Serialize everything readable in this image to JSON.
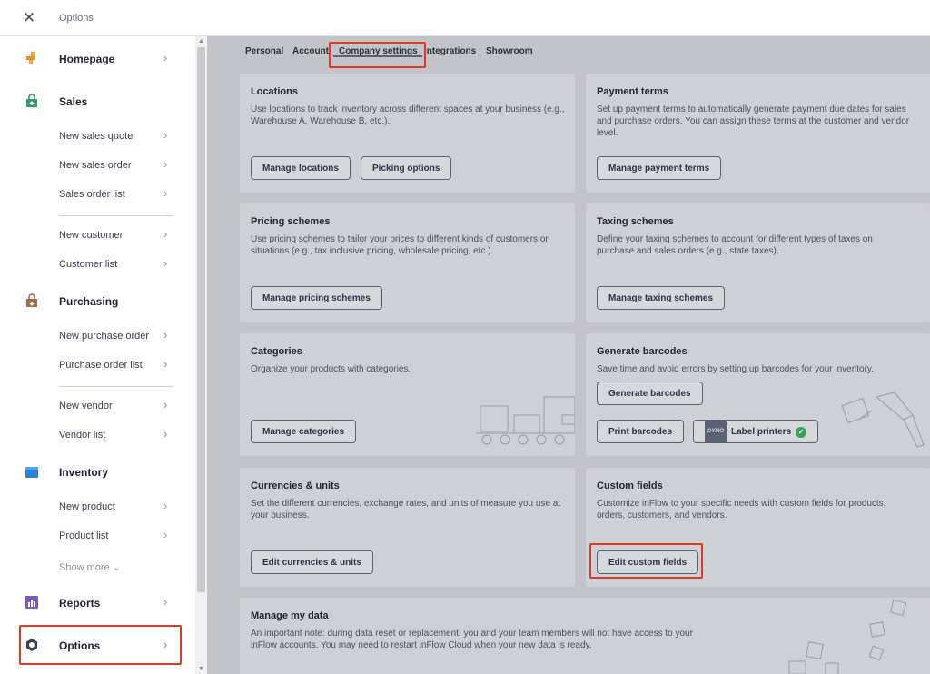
{
  "topbar": {
    "close_symbol": "✕",
    "title": "Options"
  },
  "sidebar": {
    "sections": {
      "homepage": "Homepage",
      "sales": "Sales",
      "purchasing": "Purchasing",
      "inventory": "Inventory",
      "reports": "Reports",
      "options": "Options"
    },
    "items": {
      "new_sales_quote": "New sales quote",
      "new_sales_order": "New sales order",
      "sales_order_list": "Sales order list",
      "new_customer": "New customer",
      "customer_list": "Customer list",
      "new_purchase_order": "New purchase order",
      "purchase_order_list": "Purchase order list",
      "new_vendor": "New vendor",
      "vendor_list": "Vendor list",
      "new_product": "New product",
      "product_list": "Product list",
      "show_more": "Show more ⌄"
    },
    "chevron": "›",
    "icon_names": [
      "homepage-icon",
      "sales-bag-icon",
      "purchasing-bag-icon",
      "inventory-box-icon",
      "reports-chart-icon",
      "options-gear-icon"
    ]
  },
  "tabs": {
    "personal": "Personal",
    "account": "Account",
    "company_settings": "Company settings",
    "integrations": "Integrations",
    "showroom": "Showroom"
  },
  "cards": {
    "locations": {
      "title": "Locations",
      "desc": "Use locations to track inventory across different spaces at your business (e.g., Warehouse A, Warehouse B, etc.).",
      "btn1": "Manage locations",
      "btn2": "Picking options"
    },
    "payment_terms": {
      "title": "Payment terms",
      "desc": "Set up payment terms to automatically generate payment due dates for sales and purchase orders. You can assign these terms at the customer and vendor level.",
      "btn1": "Manage payment terms"
    },
    "pricing": {
      "title": "Pricing schemes",
      "desc": "Use pricing schemes to tailor your prices to different kinds of customers or situations (e.g., tax inclusive pricing, wholesale pricing, etc.).",
      "btn1": "Manage pricing schemes"
    },
    "taxing": {
      "title": "Taxing schemes",
      "desc": "Define your taxing schemes to account for different types of taxes on purchase and sales orders (e.g., state taxes).",
      "btn1": "Manage taxing schemes"
    },
    "categories": {
      "title": "Categories",
      "desc": "Organize your products with categories.",
      "btn1": "Manage categories"
    },
    "barcodes": {
      "title": "Generate barcodes",
      "desc": "Save time and avoid errors by setting up barcodes for your inventory.",
      "btn1": "Generate barcodes",
      "btn2": "Print barcodes",
      "btn3": "Label printers",
      "dymo": "DYMO"
    },
    "currencies": {
      "title": "Currencies & units",
      "desc": "Set the different currencies, exchange rates, and units of measure you use at your business.",
      "btn1": "Edit currencies & units"
    },
    "custom_fields": {
      "title": "Custom fields",
      "desc": "Customize inFlow to your specific needs with custom fields for products, orders, customers, and vendors.",
      "btn1": "Edit custom fields"
    },
    "manage_data": {
      "title": "Manage my data",
      "desc": "An important note: during data reset or replacement, you and your team members will not have access to your inFlow accounts. You may need to restart inFlow Cloud when your new data is ready."
    }
  },
  "colors": {
    "highlight": "#d93b25",
    "check": "#3aa05a"
  }
}
